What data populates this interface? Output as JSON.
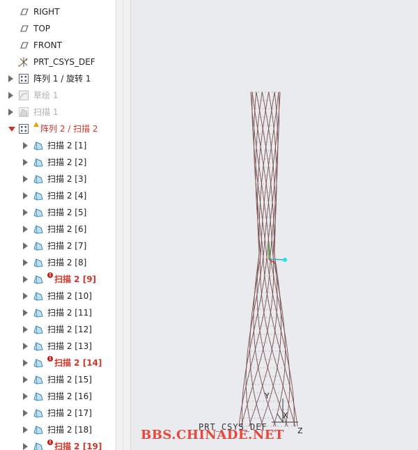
{
  "tree": {
    "items": [
      {
        "label": "RIGHT",
        "icon": "datum-plane-icon",
        "indent": 0,
        "expander": "none",
        "style": "normal"
      },
      {
        "label": "TOP",
        "icon": "datum-plane-icon",
        "indent": 0,
        "expander": "none",
        "style": "normal"
      },
      {
        "label": "FRONT",
        "icon": "datum-plane-icon",
        "indent": 0,
        "expander": "none",
        "style": "normal"
      },
      {
        "label": "PRT_CSYS_DEF",
        "icon": "csys-icon",
        "indent": 0,
        "expander": "none",
        "style": "normal"
      },
      {
        "label": "阵列 1 / 旋转 1",
        "icon": "pattern-icon",
        "indent": 0,
        "expander": "closed",
        "style": "normal"
      },
      {
        "label": "草绘 1",
        "icon": "sketch-icon",
        "indent": 0,
        "expander": "closed",
        "style": "dim"
      },
      {
        "label": "扫描 1",
        "icon": "sweep-icon-dim",
        "indent": 0,
        "expander": "closed",
        "style": "dim"
      },
      {
        "label": "阵列 2 / 扫描 2",
        "icon": "pattern-icon",
        "indent": 0,
        "expander": "open",
        "style": "warn"
      },
      {
        "label": "扫描 2 [1]",
        "icon": "sweep-icon",
        "indent": 1,
        "expander": "closed",
        "style": "normal"
      },
      {
        "label": "扫描 2 [2]",
        "icon": "sweep-icon",
        "indent": 1,
        "expander": "closed",
        "style": "normal"
      },
      {
        "label": "扫描 2 [3]",
        "icon": "sweep-icon",
        "indent": 1,
        "expander": "closed",
        "style": "normal"
      },
      {
        "label": "扫描 2 [4]",
        "icon": "sweep-icon",
        "indent": 1,
        "expander": "closed",
        "style": "normal"
      },
      {
        "label": "扫描 2 [5]",
        "icon": "sweep-icon",
        "indent": 1,
        "expander": "closed",
        "style": "normal"
      },
      {
        "label": "扫描 2 [6]",
        "icon": "sweep-icon",
        "indent": 1,
        "expander": "closed",
        "style": "normal"
      },
      {
        "label": "扫描 2 [7]",
        "icon": "sweep-icon",
        "indent": 1,
        "expander": "closed",
        "style": "normal"
      },
      {
        "label": "扫描 2 [8]",
        "icon": "sweep-icon",
        "indent": 1,
        "expander": "closed",
        "style": "normal"
      },
      {
        "label": "扫描 2 [9]",
        "icon": "sweep-icon",
        "indent": 1,
        "expander": "closed",
        "style": "error"
      },
      {
        "label": "扫描 2 [10]",
        "icon": "sweep-icon",
        "indent": 1,
        "expander": "closed",
        "style": "normal"
      },
      {
        "label": "扫描 2 [11]",
        "icon": "sweep-icon",
        "indent": 1,
        "expander": "closed",
        "style": "normal"
      },
      {
        "label": "扫描 2 [12]",
        "icon": "sweep-icon",
        "indent": 1,
        "expander": "closed",
        "style": "normal"
      },
      {
        "label": "扫描 2 [13]",
        "icon": "sweep-icon",
        "indent": 1,
        "expander": "closed",
        "style": "normal"
      },
      {
        "label": "扫描 2 [14]",
        "icon": "sweep-icon",
        "indent": 1,
        "expander": "closed",
        "style": "error"
      },
      {
        "label": "扫描 2 [15]",
        "icon": "sweep-icon",
        "indent": 1,
        "expander": "closed",
        "style": "normal"
      },
      {
        "label": "扫描 2 [16]",
        "icon": "sweep-icon",
        "indent": 1,
        "expander": "closed",
        "style": "normal"
      },
      {
        "label": "扫描 2 [17]",
        "icon": "sweep-icon",
        "indent": 1,
        "expander": "closed",
        "style": "normal"
      },
      {
        "label": "扫描 2 [18]",
        "icon": "sweep-icon",
        "indent": 1,
        "expander": "closed",
        "style": "normal"
      },
      {
        "label": "扫描 2 [19]",
        "icon": "sweep-icon",
        "indent": 1,
        "expander": "closed",
        "style": "error"
      }
    ]
  },
  "viewport": {
    "csys_label": "PRT_CSYS_DEF",
    "axis_x": "X",
    "axis_y": "Y",
    "axis_z": "Z",
    "watermark": "BBS.CHINADE.NET",
    "background": "#e9ebee",
    "wire_color": "#7a5050"
  }
}
